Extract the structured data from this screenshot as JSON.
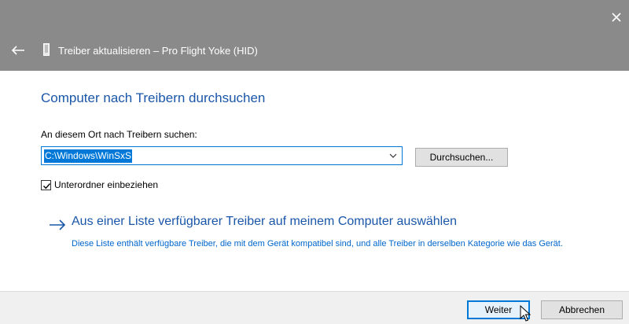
{
  "window": {
    "title": "Treiber aktualisieren – Pro Flight Yoke (HID)",
    "close_icon": "close-icon",
    "back_icon": "back-arrow-icon",
    "device_icon": "device-icon"
  },
  "main": {
    "heading": "Computer nach Treibern durchsuchen",
    "search_label": "An diesem Ort nach Treibern suchen:",
    "path_value": "C:\\Windows\\WinSxS",
    "browse_label": "Durchsuchen...",
    "include_subfolders_label": "Unterordner einbeziehen",
    "include_subfolders_checked": true,
    "list_link_text": "Aus einer Liste verfügbarer Treiber auf meinem Computer auswählen",
    "list_link_description": "Diese Liste enthält verfügbare Treiber, die mit dem Gerät kompatibel sind, und alle Treiber in derselben Kategorie wie das Gerät."
  },
  "footer": {
    "next_label": "Weiter",
    "cancel_label": "Abbrechen"
  },
  "colors": {
    "titlebar": "#8a8a8a",
    "accent": "#0078d7",
    "link": "#1a56a8"
  }
}
